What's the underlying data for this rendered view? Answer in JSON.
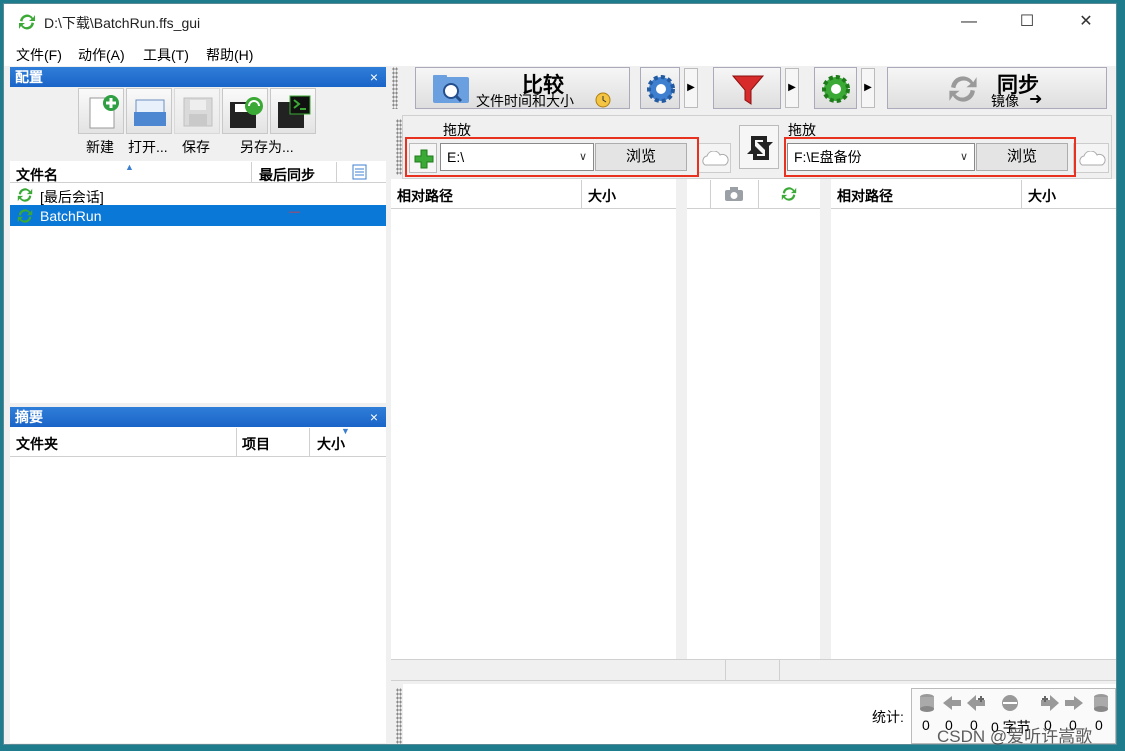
{
  "window": {
    "title": "D:\\下载\\BatchRun.ffs_gui",
    "controls": {
      "minimize": "—",
      "maximize": "☐",
      "close": "✕"
    }
  },
  "menu": [
    "文件(F)",
    "动作(A)",
    "工具(T)",
    "帮助(H)"
  ],
  "config_panel": {
    "title": "配置",
    "close": "×",
    "toolbar": {
      "new": "新建",
      "open": "打开...",
      "save": "保存",
      "save_as": "另存为..."
    },
    "columns": {
      "name": "文件名",
      "last_sync": "最后同步"
    },
    "items": [
      {
        "name": "[最后会话]",
        "last_sync": ""
      },
      {
        "name": "BatchRun",
        "last_sync": "—"
      }
    ]
  },
  "summary_panel": {
    "title": "摘要",
    "close": "×",
    "columns": {
      "folder": "文件夹",
      "items": "项目",
      "size": "大小"
    }
  },
  "toolbar": {
    "compare": {
      "label": "比较",
      "sub": "文件时间和大小"
    },
    "sync": {
      "label": "同步",
      "sub": "镜像",
      "arrow": "➜"
    }
  },
  "left_folder": {
    "drop_label": "拖放",
    "path": "E:\\",
    "browse": "浏览"
  },
  "right_folder": {
    "drop_label": "拖放",
    "path": "F:\\E盘备份",
    "browse": "浏览"
  },
  "grid": {
    "left_columns": {
      "rel_path": "相对路径",
      "size": "大小"
    },
    "right_columns": {
      "rel_path": "相对路径",
      "size": "大小"
    }
  },
  "statistics": {
    "label": "统计:",
    "values": [
      "0",
      "0",
      "0",
      "0 字节",
      "0",
      "0",
      "0"
    ]
  },
  "watermark": "CSDN @爱听许嵩歌",
  "colors": {
    "accent": "#1a64c8",
    "selection": "#0a78d7",
    "highlight_box": "#e8321f"
  }
}
